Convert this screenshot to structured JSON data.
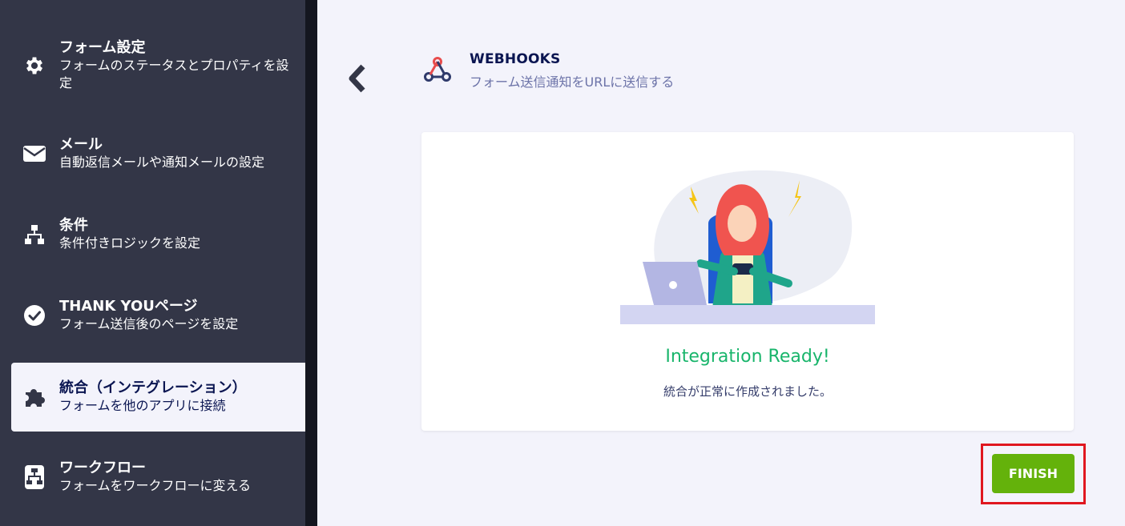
{
  "sidebar": {
    "items": [
      {
        "title": "フォーム設定",
        "desc": "フォームのステータスとプロパティを設定",
        "icon": "gear-icon"
      },
      {
        "title": "メール",
        "desc": "自動返信メールや通知メールの設定",
        "icon": "mail-icon"
      },
      {
        "title": "条件",
        "desc": "条件付きロジックを設定",
        "icon": "sitemap-icon"
      },
      {
        "title": "THANK YOUページ",
        "desc": "フォーム送信後のページを設定",
        "icon": "check-circle-icon"
      },
      {
        "title": "統合（インテグレーション）",
        "desc": "フォームを他のアプリに接続",
        "icon": "puzzle-icon"
      },
      {
        "title": "ワークフロー",
        "desc": "フォームをワークフローに変える",
        "icon": "workflow-icon"
      }
    ],
    "active_index": 4
  },
  "header": {
    "title": "WEBHOOKS",
    "subtitle": "フォーム送信通知をURLに送信する"
  },
  "card": {
    "status_title": "Integration Ready!",
    "status_desc": "統合が正常に作成されました。"
  },
  "actions": {
    "finish_label": "FINISH"
  },
  "colors": {
    "sidebar_bg": "#333647",
    "main_bg": "#f3f3fb",
    "success_green": "#18b56b",
    "finish_green": "#64b20b",
    "highlight_red": "#e0171f"
  }
}
